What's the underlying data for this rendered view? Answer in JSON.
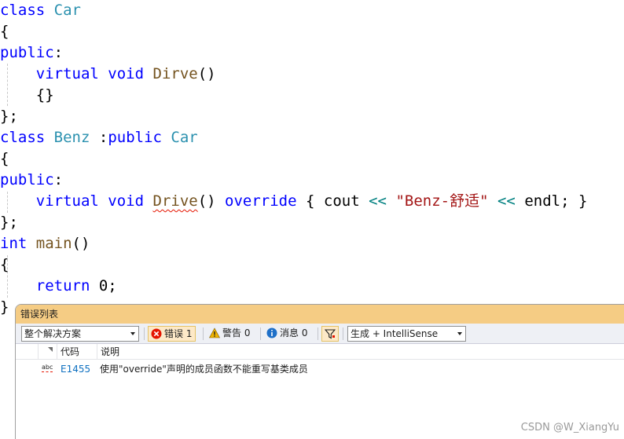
{
  "editor": {
    "lines": [
      [
        [
          "kw",
          "class"
        ],
        [
          "pn",
          " "
        ],
        [
          "ty",
          "Car"
        ]
      ],
      [
        [
          "pn",
          "{"
        ]
      ],
      [
        [
          "kw",
          "public"
        ],
        [
          "pn",
          ":"
        ]
      ],
      [
        [
          "pn",
          "    "
        ],
        [
          "kw",
          "virtual"
        ],
        [
          "pn",
          " "
        ],
        [
          "kw",
          "void"
        ],
        [
          "pn",
          " "
        ],
        [
          "fn",
          "Dirve"
        ],
        [
          "pn",
          "()"
        ]
      ],
      [
        [
          "pn",
          "    {}"
        ]
      ],
      [
        [
          "pn",
          "};"
        ]
      ],
      [
        [
          "kw",
          "class"
        ],
        [
          "pn",
          " "
        ],
        [
          "ty",
          "Benz"
        ],
        [
          "pn",
          " :"
        ],
        [
          "kw",
          "public"
        ],
        [
          "pn",
          " "
        ],
        [
          "ty",
          "Car"
        ]
      ],
      [
        [
          "pn",
          "{"
        ]
      ],
      [
        [
          "kw",
          "public"
        ],
        [
          "pn",
          ":"
        ]
      ],
      [
        [
          "pn",
          "    "
        ],
        [
          "kw",
          "virtual"
        ],
        [
          "pn",
          " "
        ],
        [
          "kw",
          "void"
        ],
        [
          "pn",
          " "
        ],
        [
          "fnsq",
          "Drive"
        ],
        [
          "pn",
          "() "
        ],
        [
          "kw",
          "override"
        ],
        [
          "pn",
          " { "
        ],
        [
          "pn",
          "cout"
        ],
        [
          "pn",
          " "
        ],
        [
          "op",
          "<<"
        ],
        [
          "pn",
          " "
        ],
        [
          "str",
          "\"Benz-舒适\""
        ],
        [
          "pn",
          " "
        ],
        [
          "op",
          "<<"
        ],
        [
          "pn",
          " "
        ],
        [
          "pn",
          "endl"
        ],
        [
          "pn",
          "; }"
        ]
      ],
      [
        [
          "pn",
          "};"
        ]
      ],
      [
        [
          "kw",
          "int"
        ],
        [
          "pn",
          " "
        ],
        [
          "fn",
          "main"
        ],
        [
          "pn",
          "()"
        ]
      ],
      [
        [
          "pn",
          "{"
        ]
      ],
      [
        [
          "pn",
          "    "
        ],
        [
          "kw",
          "return"
        ],
        [
          "pn",
          " 0;"
        ]
      ],
      [
        [
          "pn",
          "}"
        ]
      ]
    ]
  },
  "error_list": {
    "title": "错误列表",
    "scope_dropdown": "整个解决方案",
    "errors_toggle": "错误 1",
    "warnings_toggle": "警告 0",
    "messages_toggle": "消息 0",
    "filter_icon": "filter-icon",
    "build_dropdown": "生成 + IntelliSense",
    "columns": {
      "code": "代码",
      "description": "说明"
    },
    "rows": [
      {
        "badge": "abc",
        "code": "E1455",
        "description": "使用\"override\"声明的成员函数不能重写基类成员"
      }
    ],
    "colors": {
      "title_bg": "#f5cc84",
      "error_red": "#e51400",
      "warning_yellow": "#f0b400",
      "info_blue": "#1e6fc8"
    }
  },
  "watermark": "CSDN @W_XiangYu"
}
